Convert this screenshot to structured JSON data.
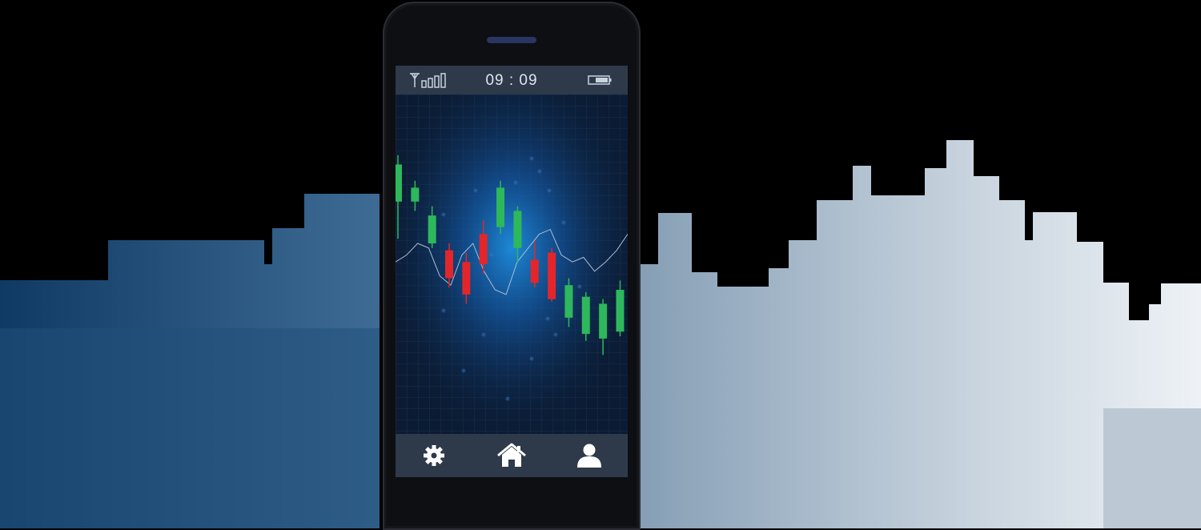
{
  "status_bar": {
    "time": "09 : 09",
    "signal_icon": "signal-antenna-icon",
    "battery_icon": "battery-icon"
  },
  "chart_data": {
    "type": "candlestick",
    "title": "",
    "xlabel": "",
    "ylabel": "",
    "ylim": [
      0,
      100
    ],
    "grid": true,
    "colors": {
      "up": "#2eb85c",
      "down": "#e3262b",
      "line": "#aebdd2"
    },
    "candles": [
      {
        "open": 78,
        "close": 94,
        "high": 98,
        "low": 62
      },
      {
        "open": 78,
        "close": 84,
        "high": 87,
        "low": 74
      },
      {
        "open": 60,
        "close": 72,
        "high": 76,
        "low": 58
      },
      {
        "open": 57,
        "close": 45,
        "high": 60,
        "low": 41
      },
      {
        "open": 52,
        "close": 38,
        "high": 56,
        "low": 34
      },
      {
        "open": 64,
        "close": 51,
        "high": 70,
        "low": 47
      },
      {
        "open": 67,
        "close": 84,
        "high": 87,
        "low": 64
      },
      {
        "open": 58,
        "close": 74,
        "high": 76,
        "low": 52
      },
      {
        "open": 53,
        "close": 43,
        "high": 61,
        "low": 41
      },
      {
        "open": 56,
        "close": 36,
        "high": 58,
        "low": 35
      },
      {
        "open": 28,
        "close": 42,
        "high": 45,
        "low": 24
      },
      {
        "open": 21,
        "close": 37,
        "high": 39,
        "low": 18
      },
      {
        "open": 19,
        "close": 34,
        "high": 36,
        "low": 12
      },
      {
        "open": 22,
        "close": 40,
        "high": 44,
        "low": 20
      }
    ],
    "series": [
      {
        "values": [
          52,
          55,
          60,
          58,
          46,
          42,
          55,
          60,
          48,
          40,
          38,
          52,
          58,
          64,
          66,
          55,
          52,
          54,
          48,
          52,
          57,
          64
        ]
      }
    ]
  },
  "nav": {
    "items": [
      {
        "icon": "gear-icon"
      },
      {
        "icon": "home-icon"
      },
      {
        "icon": "user-icon"
      }
    ]
  },
  "background": {
    "skyline_left_color": "#123b66",
    "skyline_right_color": "#dfe6ee"
  }
}
